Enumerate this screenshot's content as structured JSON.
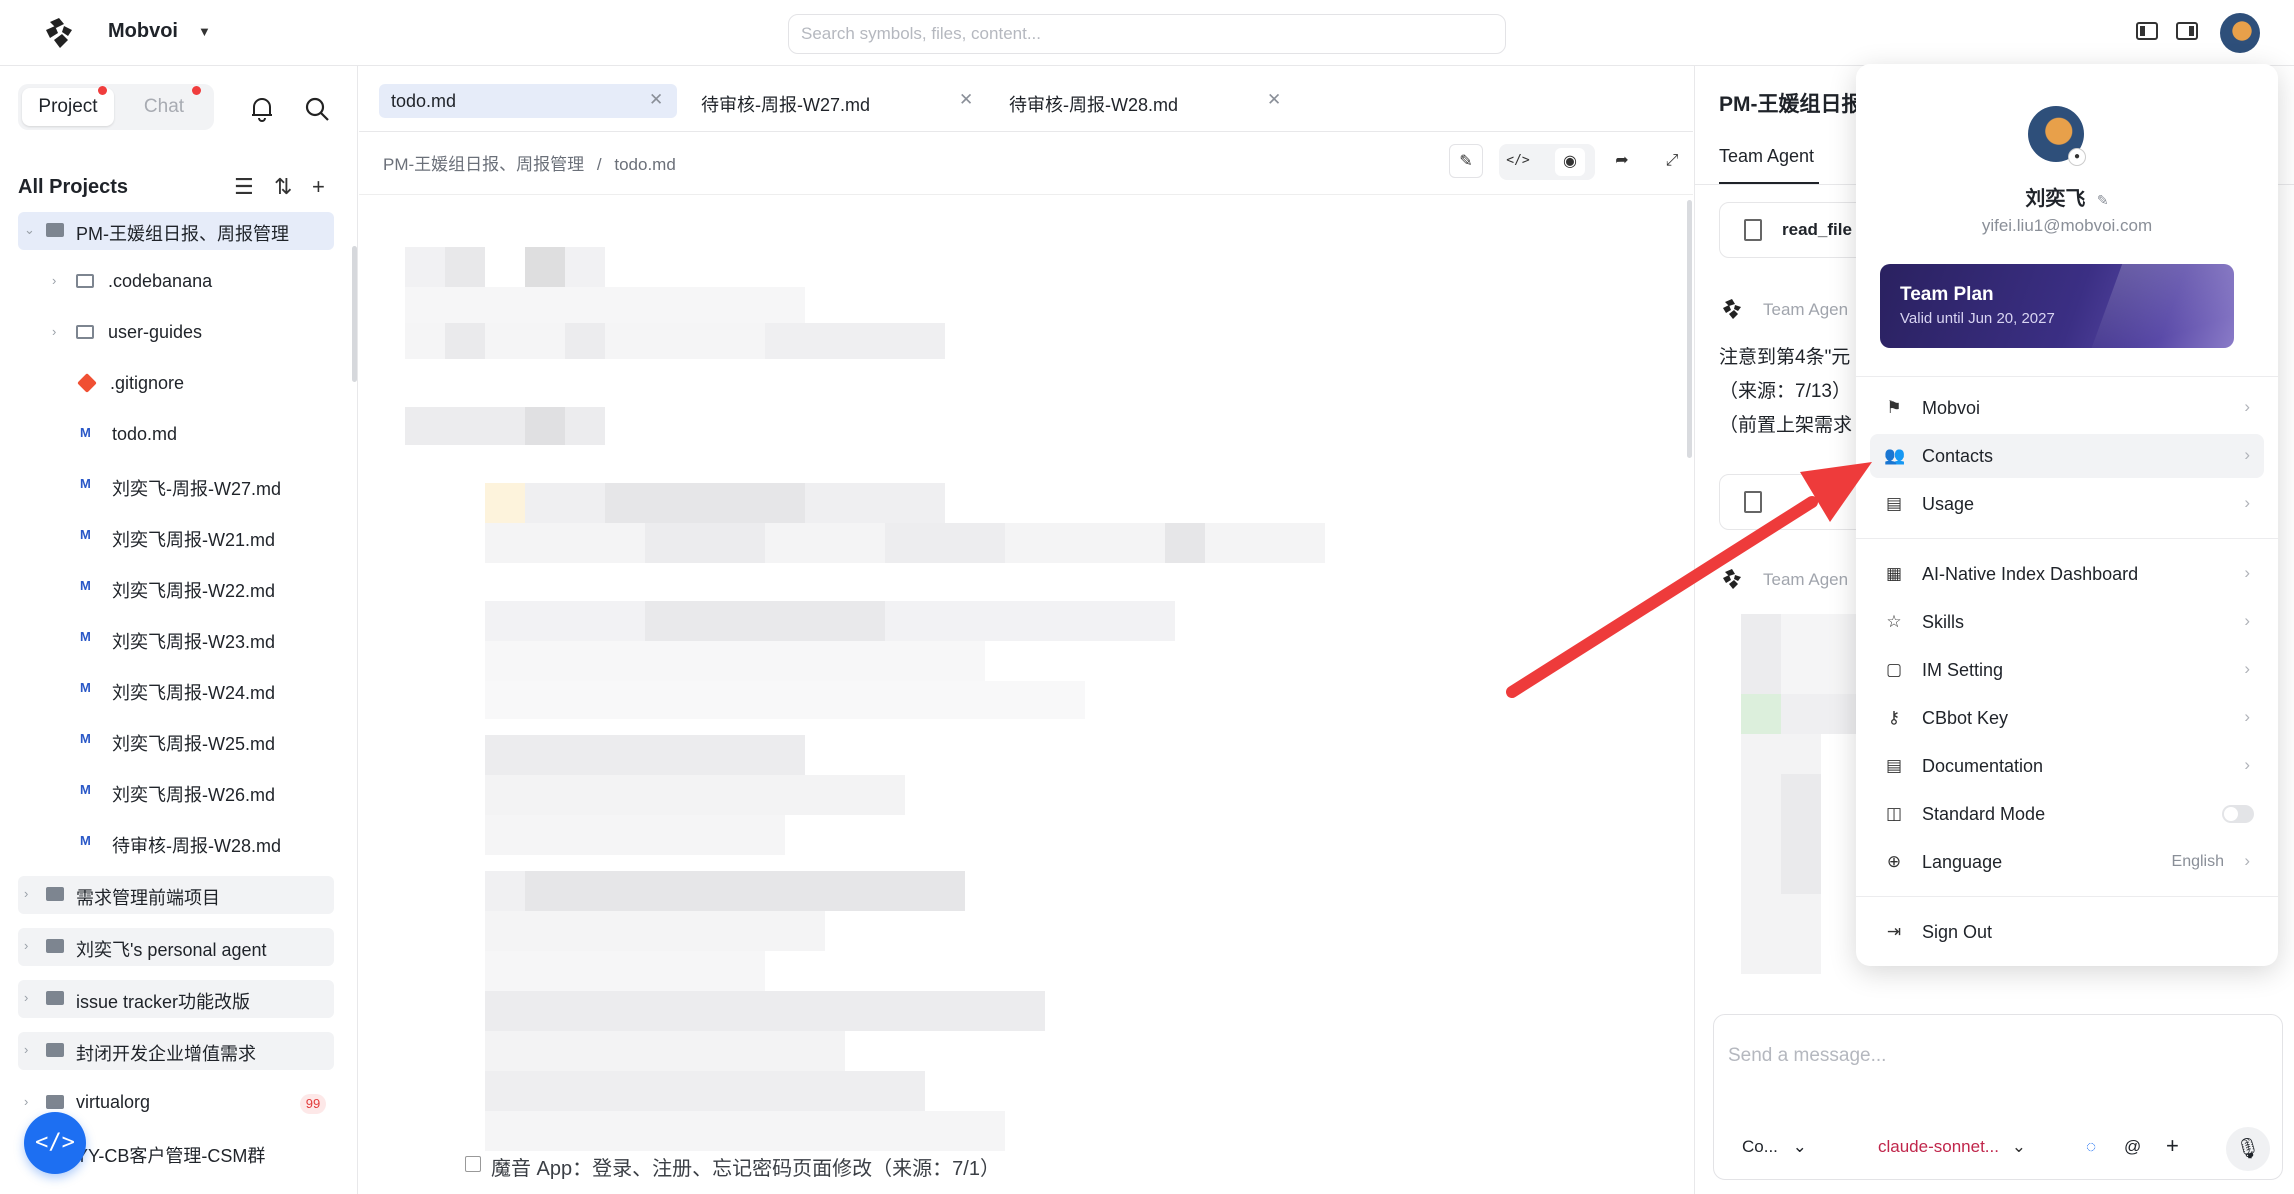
{
  "topbar": {
    "workspace": "Mobvoi",
    "search_placeholder": "Search symbols, files, content..."
  },
  "sidebar": {
    "tab_project": "Project",
    "tab_chat": "Chat",
    "section_title": "All Projects",
    "tree": [
      {
        "label": "PM-王媛组日报、周报管理",
        "kind": "project",
        "selected": true
      },
      {
        "label": ".codebanana",
        "kind": "folder"
      },
      {
        "label": "user-guides",
        "kind": "folder"
      },
      {
        "label": ".gitignore",
        "kind": "git"
      },
      {
        "label": "todo.md",
        "kind": "md"
      },
      {
        "label": "刘奕飞-周报-W27.md",
        "kind": "md"
      },
      {
        "label": "刘奕飞周报-W21.md",
        "kind": "md"
      },
      {
        "label": "刘奕飞周报-W22.md",
        "kind": "md"
      },
      {
        "label": "刘奕飞周报-W23.md",
        "kind": "md"
      },
      {
        "label": "刘奕飞周报-W24.md",
        "kind": "md"
      },
      {
        "label": "刘奕飞周报-W25.md",
        "kind": "md"
      },
      {
        "label": "刘奕飞周报-W26.md",
        "kind": "md"
      },
      {
        "label": "待审核-周报-W28.md",
        "kind": "md"
      }
    ],
    "projects": [
      {
        "label": "需求管理前端项目"
      },
      {
        "label": "刘奕飞's personal agent"
      },
      {
        "label": "issue tracker功能改版"
      },
      {
        "label": "封闭开发企业增值需求"
      },
      {
        "label": "virtualorg",
        "badge": "99"
      },
      {
        "label": "YY-CB客户管理-CSM群"
      }
    ]
  },
  "editor": {
    "tabs": [
      {
        "label": "todo.md",
        "active": true
      },
      {
        "label": "待审核-周报-W27.md"
      },
      {
        "label": "待审核-周报-W28.md"
      }
    ],
    "breadcrumb": [
      "PM-王媛组日报、周报管理",
      "/",
      "todo.md"
    ],
    "last_line": "魔音 App：登录、注册、忘记密码页面修改（来源：7/1）"
  },
  "agent": {
    "title": "PM-王媛组日报",
    "tab": "Team Agent",
    "tool_card": "read_file",
    "agent_name": "Team Agen",
    "messages": [
      "注意到第4条\"元",
      "（来源：7/13）",
      "（前置上架需求"
    ],
    "agent_name_2": "Team Agen",
    "composer_placeholder": "Send a message...",
    "mode": "Co...",
    "model": "claude-sonnet..."
  },
  "menu": {
    "name": "刘奕飞",
    "email": "yifei.liu1@mobvoi.com",
    "plan_title": "Team Plan",
    "plan_sub": "Valid until Jun 20, 2027",
    "items_group1": [
      {
        "label": "Mobvoi",
        "icon": "flag-icon"
      },
      {
        "label": "Contacts",
        "icon": "contacts-icon",
        "highlight": true
      },
      {
        "label": "Usage",
        "icon": "usage-icon"
      }
    ],
    "items_group2": [
      {
        "label": "AI-Native Index Dashboard",
        "icon": "dashboard-icon"
      },
      {
        "label": "Skills",
        "icon": "star-icon"
      },
      {
        "label": "IM Setting",
        "icon": "chat-bubble-icon"
      },
      {
        "label": "CBbot Key",
        "icon": "key-icon"
      },
      {
        "label": "Documentation",
        "icon": "document-icon"
      },
      {
        "label": "Standard Mode",
        "icon": "mode-icon",
        "toggle": true
      },
      {
        "label": "Language",
        "icon": "globe-icon",
        "value": "English"
      }
    ],
    "sign_out": "Sign Out"
  },
  "colors": {
    "accent": "#1d6ff2",
    "annotation_arrow": "#ee3b3b",
    "selected_bg": "#e6ecf9"
  }
}
